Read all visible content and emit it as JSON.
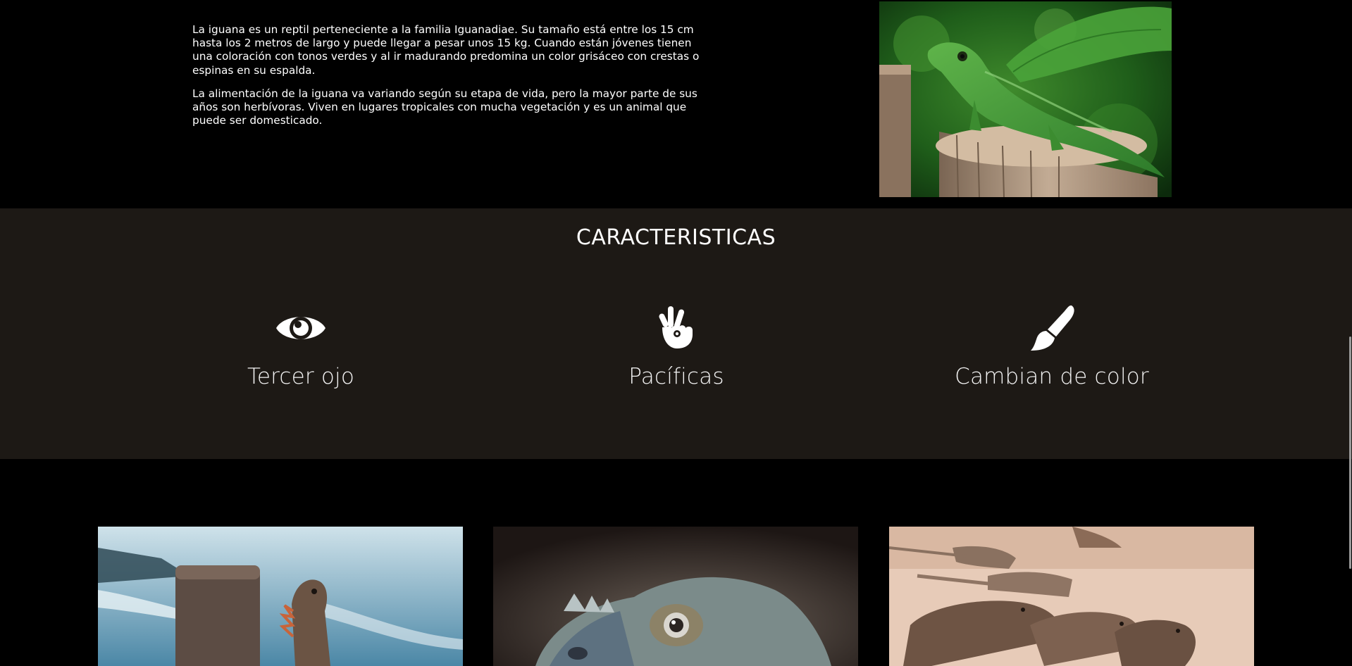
{
  "intro": {
    "paragraph1": "La iguana es un reptil perteneciente a la familia Iguanadiae. Su tamaño está entre los 15 cm hasta los 2 metros de largo y puede llegar a pesar unos 15 kg. Cuando están jóvenes tienen una coloración con tonos verdes y al ir madurando predomina un color grisáceo con crestas o espinas en su espalda.",
    "paragraph2": "La alimentación de la iguana va variando según su etapa de vida, pero la mayor parte de sus años son herbívoras. Viven en lugares tropicales con mucha vegetación y es un animal que puede ser domesticado."
  },
  "features": {
    "title": "CARACTERISTICAS",
    "items": [
      {
        "label": "Tercer ojo",
        "icon": "eye-icon"
      },
      {
        "label": "Pacíficas",
        "icon": "hand-peace-icon"
      },
      {
        "label": "Cambian de color",
        "icon": "paint-brush-icon"
      }
    ]
  },
  "colors": {
    "background": "#000000",
    "features_background": "#1d1915",
    "text": "#ffffff"
  }
}
